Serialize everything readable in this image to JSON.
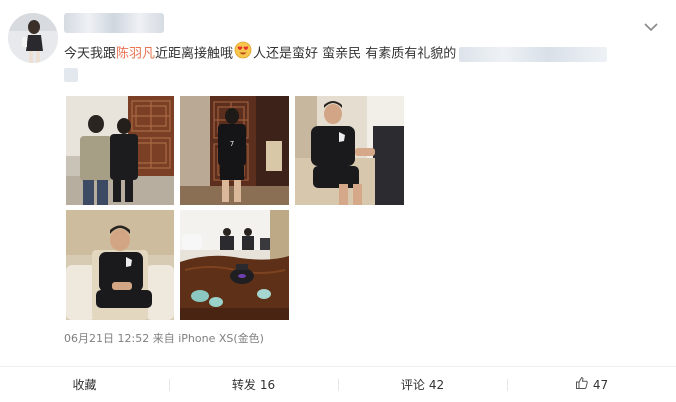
{
  "post": {
    "text_before": "今天我跟",
    "mention": "陈羽凡",
    "text_middle": "近距离接触哦",
    "text_after": "人还是蛮好 蛮亲民 有素质有礼貌的",
    "emoji_icon": "heart-eyes-emoji-icon",
    "timestamp": "06月21日 12:52",
    "source_prefix": "来自",
    "source": "iPhone XS(金色)"
  },
  "photos": [
    {
      "icon": "photo-hotel-lobby-two-men"
    },
    {
      "icon": "photo-man-back-by-door"
    },
    {
      "icon": "photo-man-seated-in-chair"
    },
    {
      "icon": "photo-man-seated-sofa"
    },
    {
      "icon": "photo-tea-table-room"
    }
  ],
  "actions": {
    "favorite_label": "收藏",
    "repost_label": "转发",
    "repost_count": "16",
    "comment_label": "评论",
    "comment_count": "42",
    "like_count": "47"
  },
  "colors": {
    "mention": "#eb7350",
    "meta": "#808080",
    "divider": "#eeeeee"
  }
}
